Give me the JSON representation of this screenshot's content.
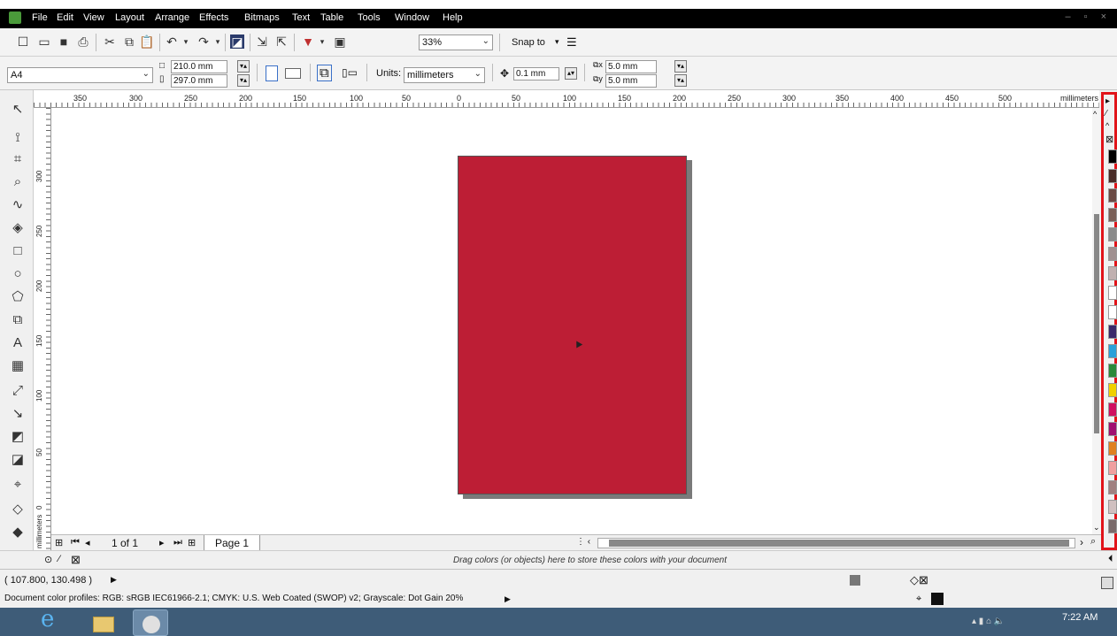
{
  "menubar": {
    "items": [
      "File",
      "Edit",
      "View",
      "Layout",
      "Arrange",
      "Effects",
      "Bitmaps",
      "Text",
      "Table",
      "Tools",
      "Window",
      "Help"
    ],
    "window_controls": "– ▫ ×"
  },
  "toolbar": {
    "zoom_value": "33%",
    "snap_label": "Snap to"
  },
  "property_bar": {
    "page_size": "A4",
    "width": "210.0 mm",
    "height": "297.0 mm",
    "units_label": "Units:",
    "units_value": "millimeters",
    "nudge": "0.1 mm",
    "dup_x": "5.0 mm",
    "dup_y": "5.0 mm"
  },
  "ruler": {
    "h_ticks": [
      "350",
      "300",
      "250",
      "200",
      "150",
      "100",
      "50",
      "0",
      "50",
      "100",
      "150",
      "200",
      "250",
      "300",
      "350",
      "400",
      "450",
      "500"
    ],
    "unit": "millimeters",
    "v_ticks": [
      "300",
      "250",
      "200",
      "150",
      "100",
      "50",
      "0"
    ],
    "v_unit": "millimeters"
  },
  "page_nav": {
    "counter": "1 of 1",
    "tab": "Page 1"
  },
  "doc_palette": {
    "hint": "Drag colors (or objects) here to store these colors with your document"
  },
  "status": {
    "coords": "( 107.800, 130.498 )",
    "profiles": "Document color profiles: RGB: sRGB IEC61966-2.1; CMYK: U.S. Web Coated (SWOP) v2; Grayscale: Dot Gain 20%"
  },
  "taskbar": {
    "time": "7:22 AM"
  },
  "colors": {
    "page_fill": "#bd1e35",
    "palette_highlight": "#e1141a",
    "taskbar": "#3e5c78"
  },
  "palette_swatches": [
    "#000000",
    "#4a2c28",
    "#6b4a44",
    "#7a6058",
    "#8a8a8a",
    "#a09090",
    "#c0b0b0",
    "#ffffff",
    "#ffffff",
    "#3a2a6a",
    "#2aa0d8",
    "#2a8a3a",
    "#f0d000",
    "#d01060",
    "#a01070",
    "#e08020",
    "#f0a0a0",
    "#a08080",
    "#d0c0c0",
    "#7a6a6a"
  ]
}
